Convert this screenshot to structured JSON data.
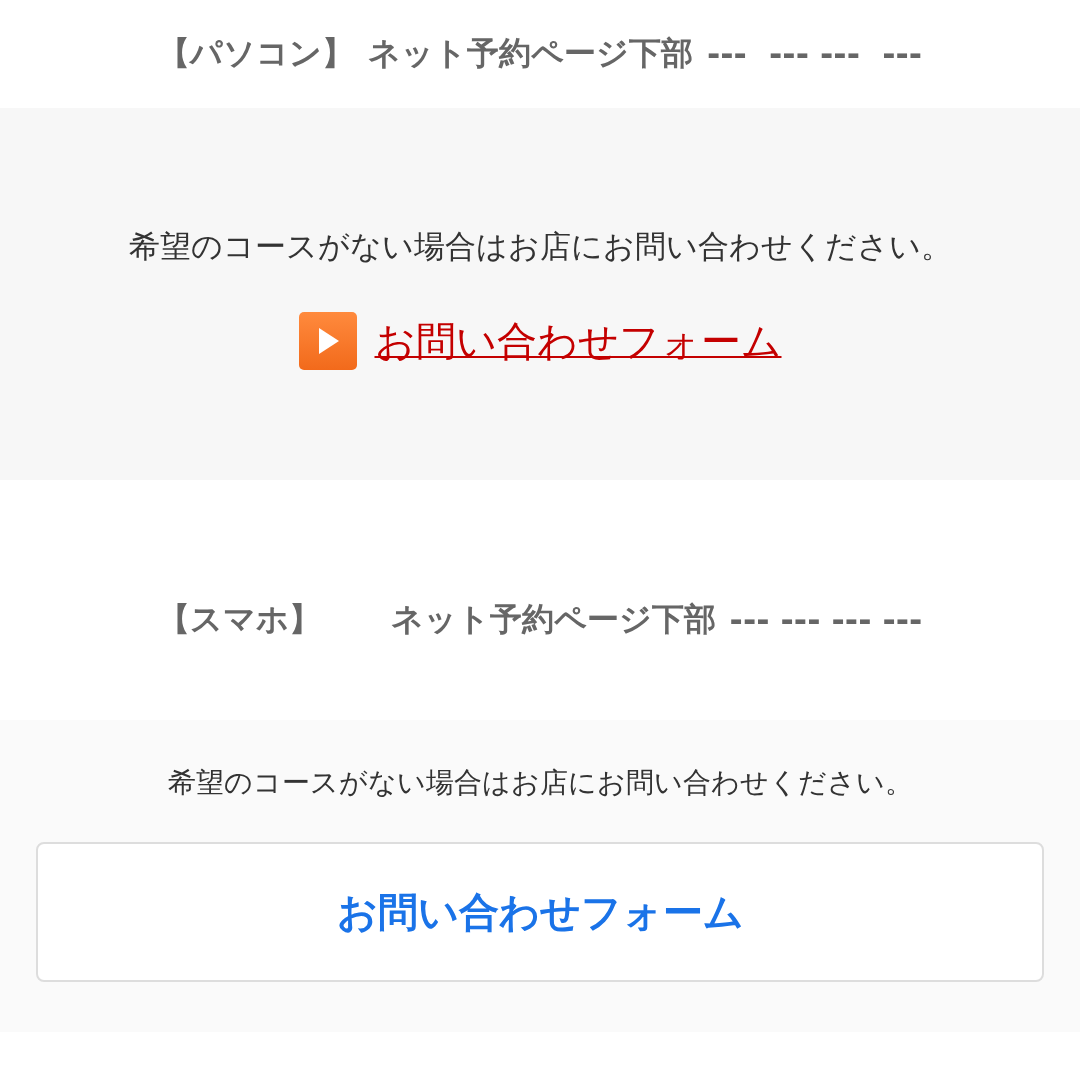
{
  "sections": [
    {
      "kind": "pc",
      "tag": "【パソコン】",
      "title": "ネット予約ページ下部",
      "dashes": "---  --- ---  ---",
      "message": "希望のコースがない場合はお店にお問い合わせください。",
      "link": "お問い合わせフォーム"
    },
    {
      "kind": "sp",
      "tag": "【スマホ】",
      "title": "ネット予約ページ下部",
      "dashes": "--- --- --- ---",
      "message": "希望のコースがない場合はお店にお問い合わせください。",
      "link": "お問い合わせフォーム"
    }
  ]
}
